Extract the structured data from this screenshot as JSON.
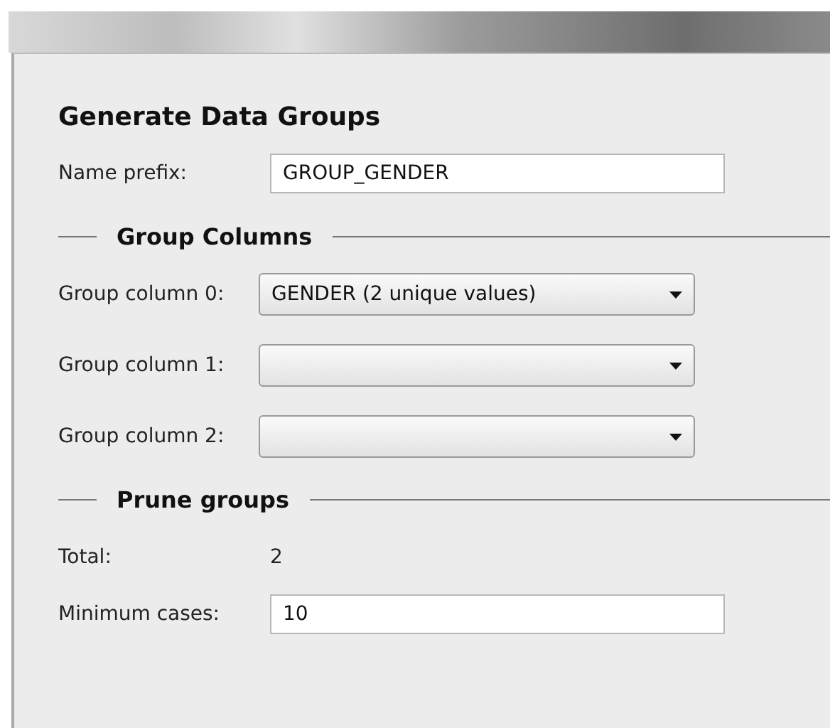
{
  "dialog": {
    "title": "Generate Data Groups"
  },
  "name_prefix": {
    "label": "Name prefix:",
    "value": "GROUP_GENDER"
  },
  "group_columns": {
    "heading": "Group Columns",
    "rows": [
      {
        "label": "Group column 0:",
        "value": "GENDER (2 unique values)"
      },
      {
        "label": "Group column 1:",
        "value": ""
      },
      {
        "label": "Group column 2:",
        "value": ""
      }
    ]
  },
  "prune_groups": {
    "heading": "Prune groups",
    "total_label": "Total:",
    "total_value": "2",
    "minimum_label": "Minimum cases:",
    "minimum_value": "10"
  }
}
